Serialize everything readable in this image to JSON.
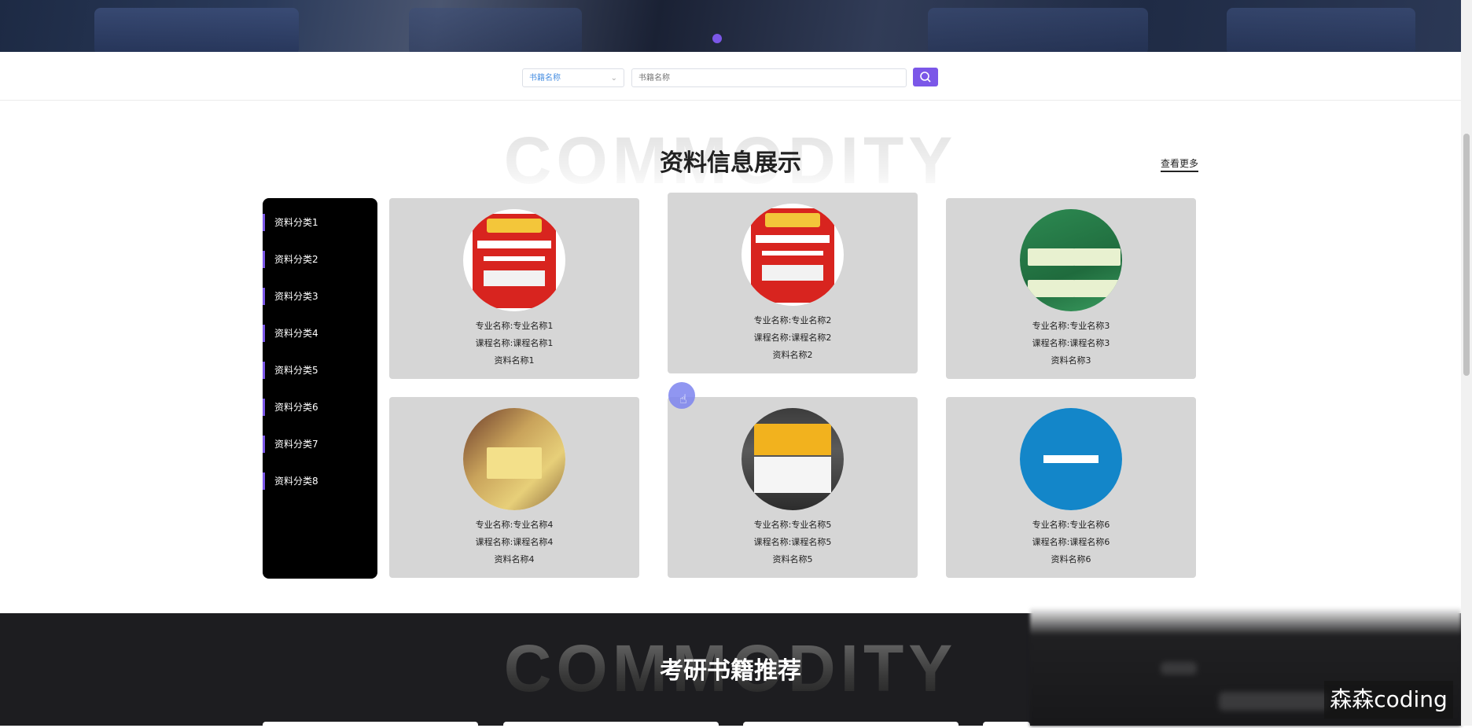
{
  "search": {
    "field_select": "书籍名称",
    "input_placeholder": "书籍名称"
  },
  "section1": {
    "bg_word": "COMMODITY",
    "title": "资料信息展示",
    "more": "查看更多"
  },
  "categories": [
    "资料分类1",
    "资料分类2",
    "资料分类3",
    "资料分类4",
    "资料分类5",
    "资料分类6",
    "资料分类7",
    "资料分类8"
  ],
  "items": [
    {
      "major": "专业名称:专业名称1",
      "course": "课程名称:课程名称1",
      "name": "资料名称1"
    },
    {
      "major": "专业名称:专业名称2",
      "course": "课程名称:课程名称2",
      "name": "资料名称2"
    },
    {
      "major": "专业名称:专业名称3",
      "course": "课程名称:课程名称3",
      "name": "资料名称3"
    },
    {
      "major": "专业名称:专业名称4",
      "course": "课程名称:课程名称4",
      "name": "资料名称4"
    },
    {
      "major": "专业名称:专业名称5",
      "course": "课程名称:课程名称5",
      "name": "资料名称5"
    },
    {
      "major": "专业名称:专业名称6",
      "course": "课程名称:课程名称6",
      "name": "资料名称6"
    }
  ],
  "section2": {
    "bg_word": "COMMODITY",
    "title": "考研书籍推荐"
  },
  "watermark": "森森coding",
  "colors": {
    "accent": "#7b57e8",
    "card_bg": "#d6d6d6",
    "sidebar_bg": "#000000",
    "dark_section_bg": "#1d1d20"
  },
  "icons": {
    "search_button": "search-icon",
    "select_arrow": "chevron-down-icon",
    "cursor": "hand-pointer-icon"
  }
}
